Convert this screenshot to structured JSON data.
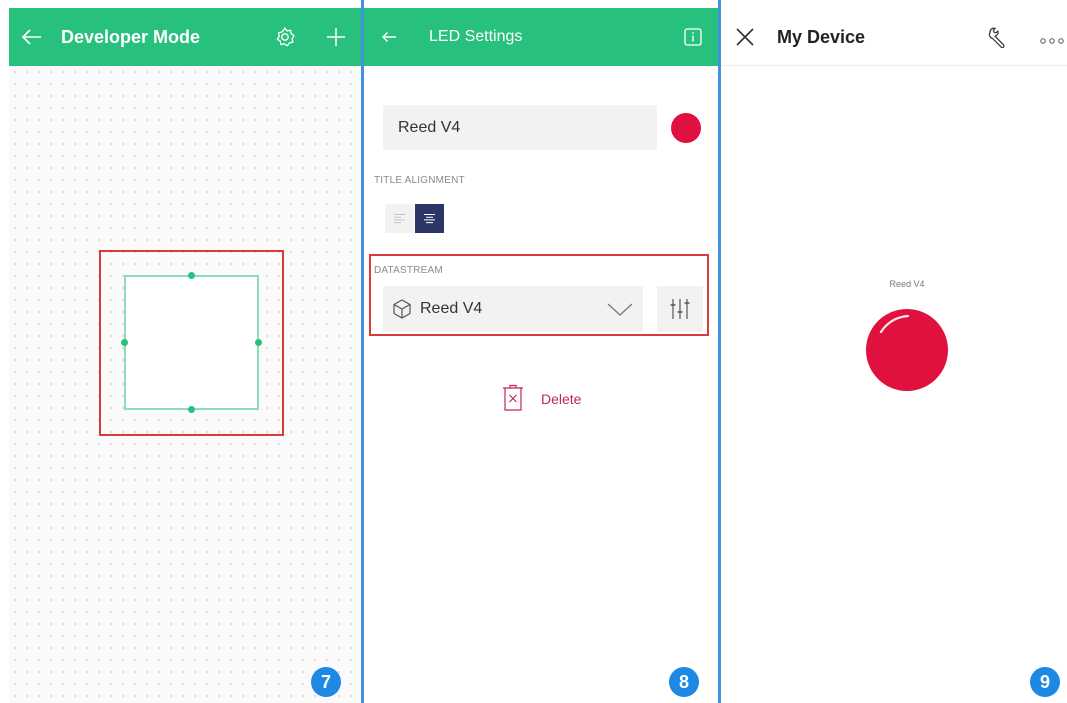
{
  "panel1": {
    "header_title": "Developer Mode",
    "back_icon": "arrow-left-icon",
    "settings_icon": "gear-icon",
    "add_icon": "plus-icon",
    "step_number": "7"
  },
  "panel2": {
    "header_title": "LED Settings",
    "back_icon": "arrow-left-icon",
    "info_icon": "info-icon",
    "widget_title_value": "Reed V4",
    "led_color": "#e0103f",
    "title_alignment_label": "TITLE ALIGNMENT",
    "datastream_label": "DATASTREAM",
    "datastream_value": "Reed V4",
    "delete_label": "Delete",
    "step_number": "8"
  },
  "panel3": {
    "header_title": "My Device",
    "close_icon": "close-icon",
    "wrench_icon": "wrench-icon",
    "more_icon": "more-icon",
    "led_label": "Reed V4",
    "step_number": "9"
  },
  "colors": {
    "accent_green": "#27c07d",
    "highlight_red": "#d93a3a",
    "led_red": "#e0103f",
    "badge_blue": "#1e88e5",
    "divider_blue": "#3f93dc",
    "delete_pink": "#c0265e",
    "align_active": "#2b3566"
  }
}
